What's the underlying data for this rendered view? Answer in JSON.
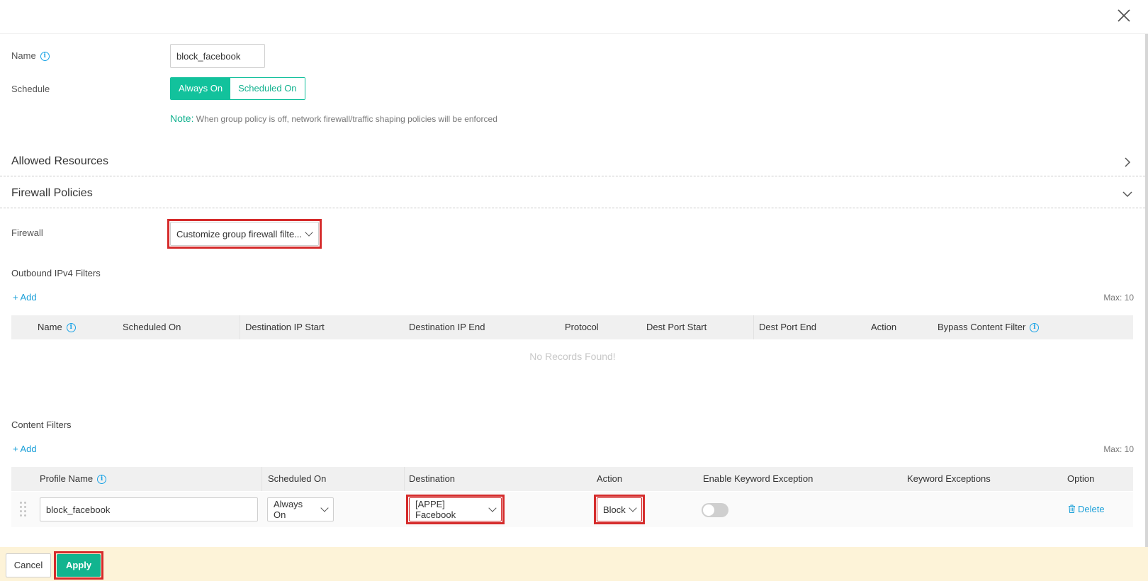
{
  "form": {
    "name_label": "Name",
    "name_value": "block_facebook",
    "schedule_label": "Schedule",
    "schedule_options": [
      "Always On",
      "Scheduled On"
    ],
    "schedule_selected": "Always On",
    "note_label": "Note:",
    "note_text": " When group policy is off, network firewall/traffic shaping policies will be enforced"
  },
  "sections": {
    "allowed_resources": "Allowed Resources",
    "firewall_policies": "Firewall Policies"
  },
  "firewall": {
    "label": "Firewall",
    "selected": "Customize group firewall filte..."
  },
  "outbound": {
    "title": "Outbound IPv4 Filters",
    "add_label": "+ Add",
    "max_label": "Max: 10",
    "columns": [
      "Name",
      "Scheduled On",
      "Destination IP Start",
      "Destination IP End",
      "Protocol",
      "Dest Port Start",
      "Dest Port End",
      "Action",
      "Bypass Content Filter"
    ],
    "empty_text": "No Records Found!"
  },
  "content_filters": {
    "title": "Content Filters",
    "add_label": "+ Add",
    "max_label": "Max: 10",
    "columns": [
      "Profile Name",
      "Scheduled On",
      "Destination",
      "Action",
      "Enable Keyword Exception",
      "Keyword Exceptions",
      "Option"
    ],
    "rows": [
      {
        "profile_name": "block_facebook",
        "scheduled_on": "Always On",
        "destination": "[APPE] Facebook",
        "action": "Block",
        "keyword_exception_enabled": false,
        "keyword_exceptions": "",
        "option_label": "Delete"
      }
    ]
  },
  "footer": {
    "cancel_label": "Cancel",
    "apply_label": "Apply"
  },
  "colors": {
    "accent": "#12c29c",
    "link": "#1a9fd8",
    "highlight": "#d52b2b",
    "footer_bg": "#fdf3d8"
  }
}
